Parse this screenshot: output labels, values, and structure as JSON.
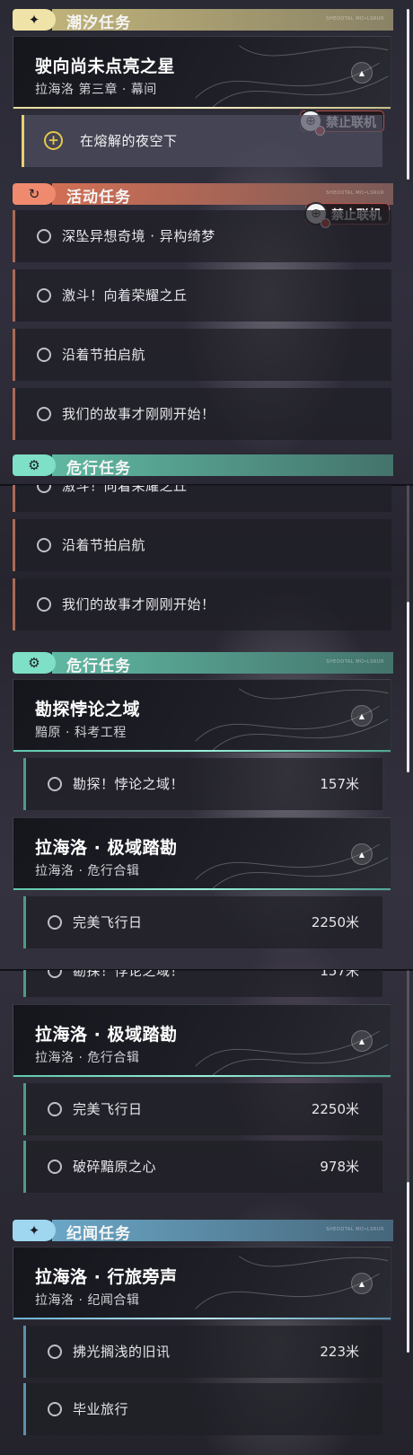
{
  "categories": {
    "tide": {
      "label": "潮汐任务",
      "icon": "✦"
    },
    "event": {
      "label": "活动任务",
      "icon": "↻"
    },
    "danger": {
      "label": "危行任务",
      "icon": "⚙"
    },
    "chronicle": {
      "label": "纪闻任务",
      "icon": "✦"
    }
  },
  "header_tiny": "SHEOOTAL MO•LSRUR",
  "tide_card": {
    "title": "驶向尚未点亮之星",
    "subtitle": "拉海洛 第三章 · 幕间"
  },
  "tide_task": {
    "label": "在熔解的夜空下"
  },
  "no_online": {
    "label": "禁止联机"
  },
  "event_tasks": [
    {
      "label": "深坠异想奇境 · 异构绮梦"
    },
    {
      "label": "激斗！向着荣耀之丘"
    },
    {
      "label": "沿着节拍启航"
    },
    {
      "label": "我们的故事才刚刚开始！"
    }
  ],
  "danger_cards": [
    {
      "title": "勘探悖论之域",
      "subtitle": "黯原 · 科考工程"
    },
    {
      "title": "拉海洛 · 极域踏勘",
      "subtitle": "拉海洛 · 危行合辑"
    }
  ],
  "danger_tasks": [
    {
      "label": "勘探！悖论之域！",
      "distance": "157米"
    },
    {
      "label": "完美飞行日",
      "distance": "2250米"
    },
    {
      "label": "破碎黯原之心",
      "distance": "978米"
    }
  ],
  "chronicle_card": {
    "title": "拉海洛 · 行旅旁声",
    "subtitle": "拉海洛 · 纪闻合辑"
  },
  "chronicle_tasks": [
    {
      "label": "拂光搁浅的旧讯",
      "distance": "223米"
    },
    {
      "label": "毕业旅行"
    }
  ],
  "colors": {
    "tide": "#efe3a8",
    "event": "#f08a6e",
    "danger": "#7ee0c6",
    "chronicle": "#9fd6f0",
    "no_online_border": "#b5524f"
  }
}
